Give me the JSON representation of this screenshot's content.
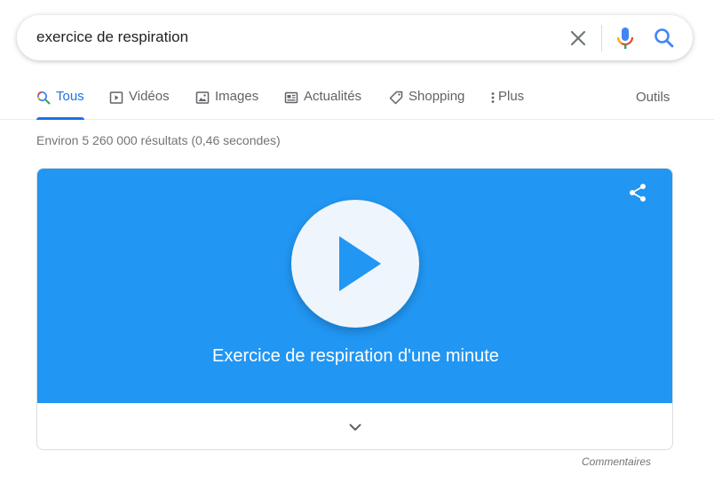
{
  "search": {
    "query": "exercice de respiration"
  },
  "tabs": [
    {
      "label": "Tous",
      "icon": "search-icon",
      "active": true
    },
    {
      "label": "Vidéos",
      "icon": "video-icon"
    },
    {
      "label": "Images",
      "icon": "image-icon"
    },
    {
      "label": "Actualités",
      "icon": "news-icon"
    },
    {
      "label": "Shopping",
      "icon": "tag-icon"
    },
    {
      "label": "Plus",
      "icon": "more-vertical-icon"
    }
  ],
  "tools_label": "Outils",
  "result_stats": "Environ 5 260 000 résultats (0,46 secondes)",
  "video_card": {
    "title": "Exercice de respiration d'une minute",
    "background_color": "#2196f3"
  },
  "feedback_label": "Commentaires",
  "colors": {
    "accent": "#1a73e8",
    "muted_text": "#5f6368"
  }
}
